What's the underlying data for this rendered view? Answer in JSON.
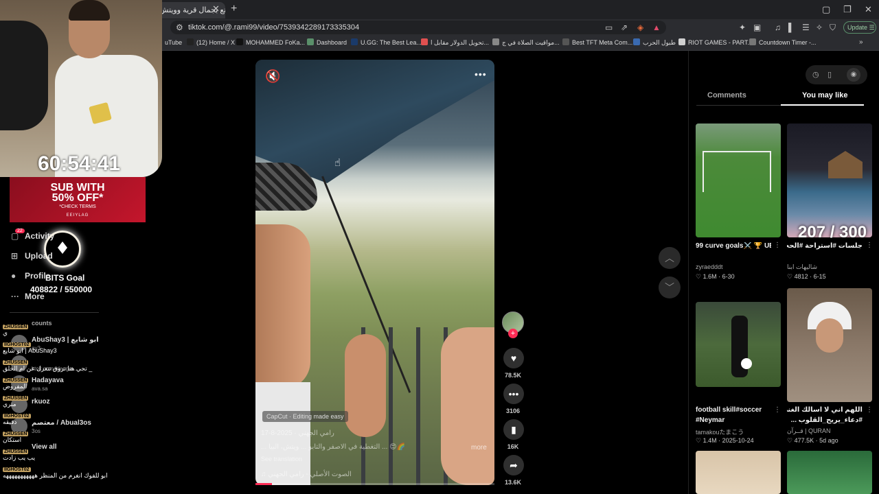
{
  "browser": {
    "tab_title": "استمتع بجمال قرية وويتش",
    "close_glyph": "✕",
    "new_tab_glyph": "+",
    "url": "tiktok.com/@.rami99/video/7539342289173335304",
    "update_label": "Update",
    "bookmarks": [
      {
        "label": "uTube",
        "color": "#ff0000"
      },
      {
        "label": "(12) Home / X",
        "color": "#222222"
      },
      {
        "label": "MOHAMMED FoKa...",
        "color": "#111111"
      },
      {
        "label": "Dashboard",
        "color": "#5a8f6a"
      },
      {
        "label": "U.GG: The Best Lea...",
        "color": "#1a3a6a"
      },
      {
        "label": "تحويل الدولار مقابل ا...",
        "color": "#e05050"
      },
      {
        "label": "مواقيت الصلاة في ج...",
        "color": "#888888"
      },
      {
        "label": "Best TFT Meta Com...",
        "color": "#555555"
      },
      {
        "label": "طبول الحرب",
        "color": "#3a6ab0"
      },
      {
        "label": "RIOT GAMES - PART...",
        "color": "#d0d0d0"
      },
      {
        "label": "Countdown Timer -...",
        "color": "#777777"
      }
    ]
  },
  "stream": {
    "timer": "60:54:41",
    "sub_banner": {
      "top": "SUB WITH",
      "main": "50% OFF*",
      "terms": "*CHECK TERMS",
      "brand": "EEIYLAG"
    },
    "bits_goal_label": "BITS Goal",
    "bits_goal_count": "408822 / 550000",
    "chat": [
      {
        "badge": "ZHUSSEN",
        "text": "ي"
      },
      {
        "badge": "IIGHOST02",
        "text": "ابو شايع | AbuShay3"
      },
      {
        "badge": "ZHUSSEN",
        "text": "تجي هنا تروق تتغزل عن ام الخلق _"
      },
      {
        "badge": "ZHUSSEN",
        "text": "المفروض"
      },
      {
        "badge": "ZHUSSEN",
        "text": "متري"
      },
      {
        "badge": "IIGHOST02",
        "text": "دقيقه"
      },
      {
        "badge": "ZHUSSEN",
        "text": "استكان"
      },
      {
        "badge": "ZHUSSEN",
        "text": "يب يب زادت"
      },
      {
        "badge": "IIGHOST02",
        "text": "ابو للفوك انغرم من المنظر هههههههههههه"
      }
    ]
  },
  "tiktok_nav": {
    "activity": "Activity",
    "activity_badge": "22",
    "upload": "Upload",
    "profile": "Profile",
    "more": "More",
    "accounts_header": "counts",
    "accounts": [
      {
        "name": "AbuShay3 | ابو شايع",
        "handle": "ay3"
      },
      {
        "name": "",
        "handle": "ktok.comedenge..."
      },
      {
        "name": "Hadayava",
        "handle": "ava.sa"
      },
      {
        "name": "rkuoz",
        "handle": ""
      },
      {
        "name": "معتصم / Abual3os",
        "handle": "3os"
      }
    ],
    "view_all": "View all"
  },
  "video": {
    "capcut": "CapCut · Editing made easy",
    "author_date": "رامي الجهني · 2025-8-17",
    "caption": "... التغطية في الاصفر والتابو ... ويتش، البيا ... 😍🌈",
    "see_translation": "See translation",
    "sound": "♫ الصوت الأصلي - رامي الجهني",
    "more": "more",
    "progress": 0.07
  },
  "actions": {
    "likes": "78.5K",
    "comments": "3106",
    "saves": "16K",
    "shares": "13.6K"
  },
  "panel": {
    "tab_comments": "Comments",
    "tab_you_may_like": "You may like",
    "counter_overlay": "207 / 300",
    "cards": [
      {
        "title": "99 curve goals⚔️ 🏆 UEFA Champions...",
        "line2": "UEFA Champions...",
        "author": "zyraedddt",
        "likes": "1.6M",
        "date": "6-30"
      },
      {
        "title": "جلسات #استراحة #الحجز_الان #اكشابور...",
        "line2": "#اكشابور...",
        "author": "شاليهات ابنا",
        "likes": "4812",
        "date": "6-15"
      },
      {
        "title": "football skill#soccer",
        "line2": "#Neymar",
        "author": "tamakouたまこう",
        "likes": "1.4M",
        "date": "2025-10-24"
      },
      {
        "title": "اللهم اني لا اسالك الغنى",
        "line2": "#دعاء_يريح_القلوب ...",
        "author": "قــرآن | QURAN",
        "likes": "477.5K",
        "date": "5d ago"
      }
    ]
  }
}
